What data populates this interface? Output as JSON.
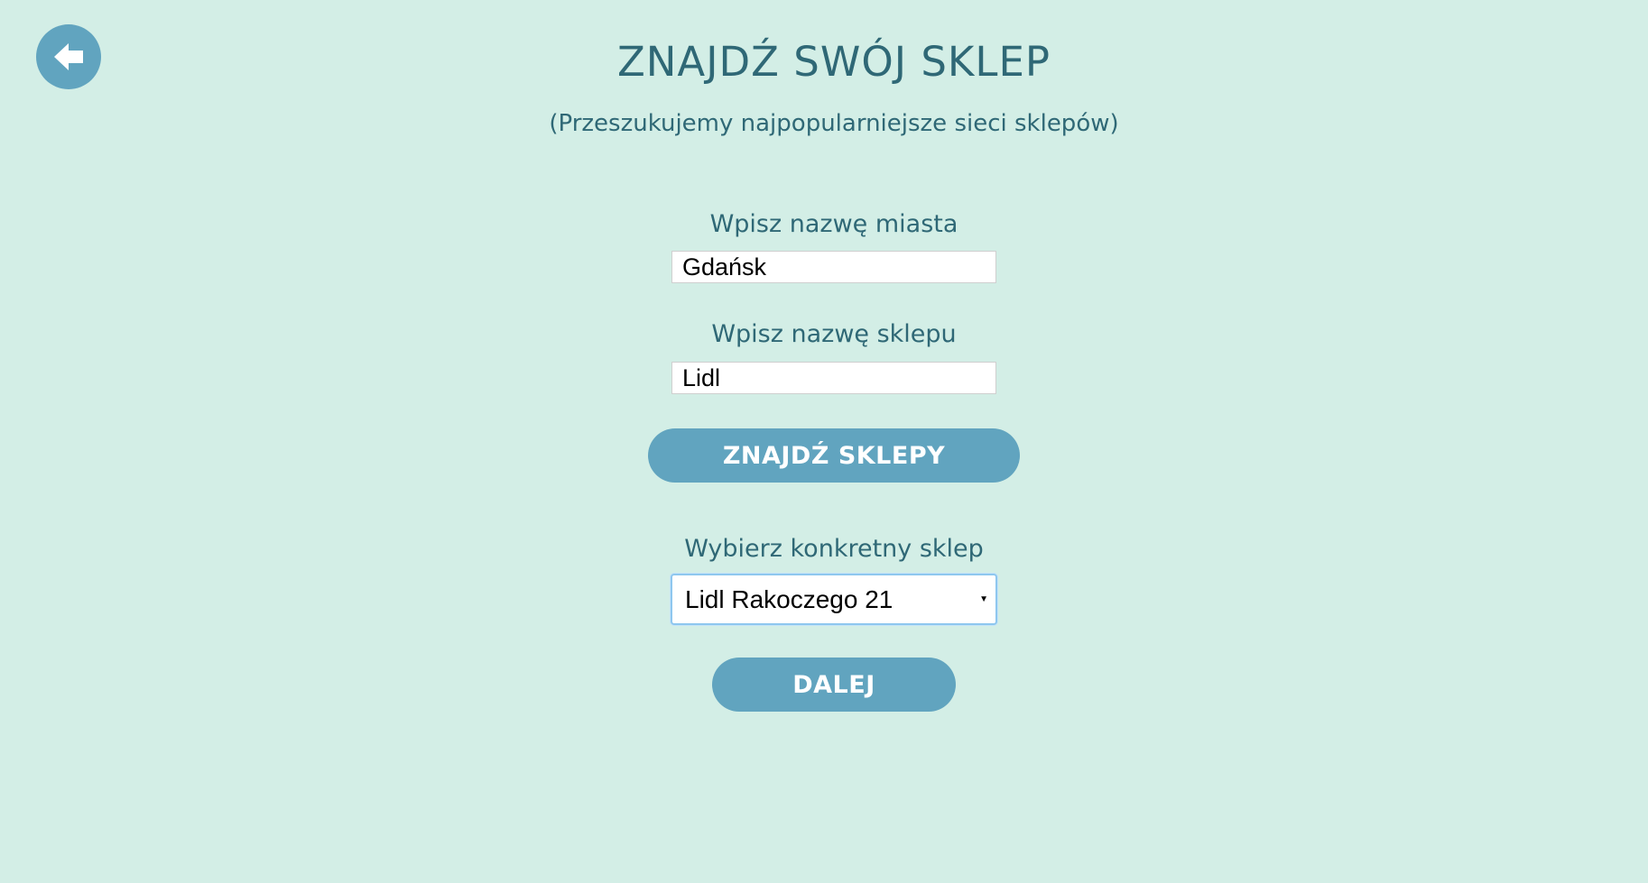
{
  "header": {
    "back_icon": "arrow-left-circle-icon",
    "title": "ZNAJDŹ SWÓJ SKLEP",
    "subtitle": "(Przeszukujemy najpopularniejsze sieci sklepów)"
  },
  "form": {
    "city": {
      "label": "Wpisz nazwę miasta",
      "value": "Gdańsk",
      "placeholder": ""
    },
    "store": {
      "label": "Wpisz nazwę sklepu",
      "value": "Lidl",
      "placeholder": ""
    },
    "find_button_label": "ZNAJDŹ SKLEPY",
    "store_select": {
      "label": "Wybierz konkretny sklep",
      "selected": "Lidl Rakoczego 21",
      "arrow_icon": "dropdown-arrow-icon"
    },
    "next_button_label": "DALEJ"
  },
  "colors": {
    "background": "#d3eee6",
    "accent": "#61a4bf",
    "text": "#2f6876"
  }
}
